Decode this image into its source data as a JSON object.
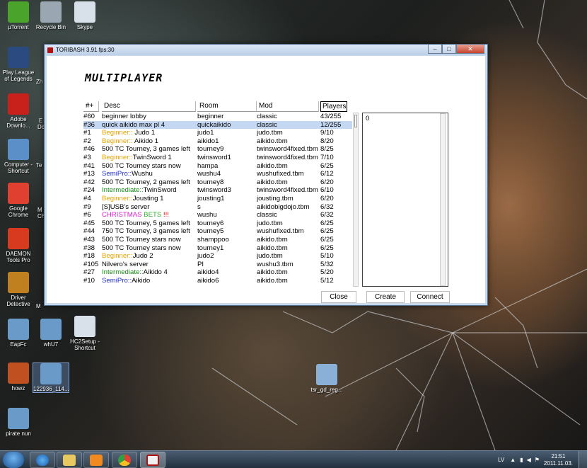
{
  "desktop": {
    "icons": [
      {
        "label": "µTorrent",
        "icon": "utorrent-icon",
        "color": "#4aa32a"
      },
      {
        "label": "Recycle Bin",
        "icon": "recycle-bin-icon",
        "color": "#9aa7b3"
      },
      {
        "label": "Skype",
        "icon": "skype-icon",
        "color": "#d8e0ea"
      },
      {
        "label": "Play League of Legends",
        "icon": "league-of-legends-icon",
        "color": "#2a4a80"
      },
      {
        "label": "Adobe Downlo...",
        "icon": "adobe-icon",
        "color": "#c8201a"
      },
      {
        "label": "Computer - Shortcut",
        "icon": "computer-icon",
        "color": "#5b8fc8"
      },
      {
        "label": "Google Chrome",
        "icon": "chrome-icon",
        "color": "#e04030"
      },
      {
        "label": "DAEMON Tools Pro",
        "icon": "daemon-tools-icon",
        "color": "#d83a20"
      },
      {
        "label": "Driver Detective",
        "icon": "driver-detective-icon",
        "color": "#c08020"
      },
      {
        "label": "EapFc",
        "icon": "image-file-icon",
        "color": "#6a9ac8"
      },
      {
        "label": "whU7",
        "icon": "image-file-icon",
        "color": "#6a9ac8"
      },
      {
        "label": "HC2Setup - Shortcut",
        "icon": "setup-icon",
        "color": "#d8e0ea"
      },
      {
        "label": "howz",
        "icon": "image-file-icon",
        "color": "#c05020"
      },
      {
        "label": "122936_114...",
        "icon": "image-file-icon",
        "color": "#6a9ac8"
      },
      {
        "label": "pirate nun",
        "icon": "image-file-icon",
        "color": "#6a9ac8"
      },
      {
        "label": "tsr_gd_reg...",
        "icon": "installer-icon",
        "color": "#8ab0d8"
      }
    ],
    "partial_labels": [
      "Zh",
      "E",
      "Do",
      "Te",
      "M",
      "Ch",
      "M"
    ]
  },
  "window": {
    "title": "TORIBASH 3.91 fps:30",
    "heading": "MULTIPLAYER",
    "columns": {
      "num": "#+",
      "desc": "Desc",
      "room": "Room",
      "mod": "Mod",
      "players": "Players"
    },
    "rows": [
      {
        "num": "#60",
        "desc_prefix": "",
        "desc": "beginner lobby",
        "room": "beginner",
        "mod": "classic",
        "players": "43/255",
        "tier": ""
      },
      {
        "num": "#36",
        "desc_prefix": "",
        "desc": "quick aikido max pl 4",
        "room": "quickaikido",
        "mod": "classic",
        "players": "12/255",
        "tier": "",
        "selected": true
      },
      {
        "num": "#1",
        "desc_prefix": "Beginner::",
        "desc": " Judo 1",
        "room": "judo1",
        "mod": "judo.tbm",
        "players": "9/10",
        "tier": "beg"
      },
      {
        "num": "#2",
        "desc_prefix": "Beginner::",
        "desc": " Aikido 1",
        "room": "aikido1",
        "mod": "aikido.tbm",
        "players": "8/20",
        "tier": "beg"
      },
      {
        "num": "#46",
        "desc_prefix": "",
        "desc": "500 TC Tourney, 3 games left",
        "room": "tourney9",
        "mod": "twinsword4fixed.tbm",
        "players": "8/25",
        "tier": ""
      },
      {
        "num": "#3",
        "desc_prefix": "Beginner::",
        "desc": "TwinSword 1",
        "room": "twinsword1",
        "mod": "twinsword4fixed.tbm",
        "players": "7/10",
        "tier": "beg"
      },
      {
        "num": "#41",
        "desc_prefix": "",
        "desc": "500 TC Tourney stars now",
        "room": "hampa",
        "mod": "aikido.tbm",
        "players": "6/25",
        "tier": ""
      },
      {
        "num": "#13",
        "desc_prefix": "SemiPro::",
        "desc": "Wushu",
        "room": "wushu4",
        "mod": "wushufixed.tbm",
        "players": "6/12",
        "tier": "semi"
      },
      {
        "num": "#42",
        "desc_prefix": "",
        "desc": "500 TC Tourney, 2 games left",
        "room": "tourney8",
        "mod": "aikido.tbm",
        "players": "6/20",
        "tier": ""
      },
      {
        "num": "#24",
        "desc_prefix": "Intermediate::",
        "desc": "TwinSword",
        "room": "twinsword3",
        "mod": "twinsword4fixed.tbm",
        "players": "6/10",
        "tier": "inter"
      },
      {
        "num": "#4",
        "desc_prefix": "Beginner::",
        "desc": "Jousting 1",
        "room": "jousting1",
        "mod": "jousting.tbm",
        "players": "6/20",
        "tier": "beg"
      },
      {
        "num": "#9",
        "desc_prefix": "",
        "desc": "[S]USB's server",
        "room": "s",
        "mod": "aikidobigdojo.tbm",
        "players": "6/32",
        "tier": ""
      },
      {
        "num": "#6",
        "desc_prefix": "",
        "desc": "",
        "room": "wushu",
        "mod": "classic",
        "players": "6/32",
        "tier": "xmas"
      },
      {
        "num": "#45",
        "desc_prefix": "",
        "desc": "500 TC Tourney, 5 games left",
        "room": "tourney6",
        "mod": "judo.tbm",
        "players": "6/25",
        "tier": ""
      },
      {
        "num": "#44",
        "desc_prefix": "",
        "desc": "750 TC Tourney, 3 games left",
        "room": "tourney5",
        "mod": "wushufixed.tbm",
        "players": "6/25",
        "tier": ""
      },
      {
        "num": "#43",
        "desc_prefix": "",
        "desc": "500 TC Tourney stars now",
        "room": "shamppoo",
        "mod": "aikido.tbm",
        "players": "6/25",
        "tier": ""
      },
      {
        "num": "#38",
        "desc_prefix": "",
        "desc": "500 TC Tourney stars now",
        "room": "tourney1",
        "mod": "aikido.tbm",
        "players": "6/25",
        "tier": ""
      },
      {
        "num": "#18",
        "desc_prefix": "Beginner::",
        "desc": "Judo 2",
        "room": "judo2",
        "mod": "judo.tbm",
        "players": "5/10",
        "tier": "beg"
      },
      {
        "num": "#105",
        "desc_prefix": "",
        "desc": "Nilvero's server",
        "room": "PI",
        "mod": "wushu3.tbm",
        "players": "5/32",
        "tier": ""
      },
      {
        "num": "#27",
        "desc_prefix": "Intermediate::",
        "desc": "Aikido 4",
        "room": "aikido4",
        "mod": "aikido.tbm",
        "players": "5/20",
        "tier": "inter"
      },
      {
        "num": "#10",
        "desc_prefix": "SemiPro::",
        "desc": "Aikido",
        "room": "aikido6",
        "mod": "aikido.tbm",
        "players": "5/12",
        "tier": "semi"
      }
    ],
    "xmas_desc": {
      "part1": "CHRISTMAS ",
      "part2": "BETS",
      "part3": " !!!"
    },
    "side_value": "0",
    "buttons": {
      "close": "Close",
      "create": "Create",
      "connect": "Connect"
    }
  },
  "taskbar": {
    "language": "LV",
    "time": "21:51",
    "date": "2011.11.03."
  }
}
